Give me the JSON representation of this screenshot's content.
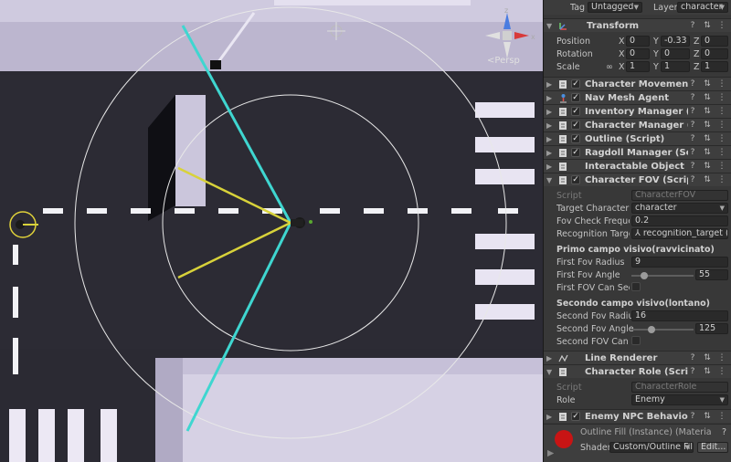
{
  "scene": {
    "persp_label": "Persp",
    "gizmo": {
      "x": "x",
      "y": "y",
      "z": "z"
    }
  },
  "inspector": {
    "top": {
      "tag_label": "Tag",
      "tag_value": "Untagged",
      "layer_label": "Layer",
      "layer_value": "character"
    },
    "transform": {
      "title": "Transform",
      "position_label": "Position",
      "position": {
        "x": "0",
        "y": "-0.33",
        "z": "0"
      },
      "rotation_label": "Rotation",
      "rotation": {
        "x": "0",
        "y": "0",
        "z": "0"
      },
      "scale_label": "Scale",
      "scale": {
        "x": "1",
        "y": "1",
        "z": "1"
      }
    },
    "components": [
      "Character Movement (Script)",
      "Nav Mesh Agent",
      "Inventory Manager (Script)",
      "Character Manager (Script)",
      "Outline (Script)",
      "Ragdoll Manager (Script)",
      "Interactable Object (Script)",
      "Character FOV (Script)"
    ],
    "fov": {
      "script_label": "Script",
      "script_value": "CharacterFOV",
      "target_label": "Target Character Ma",
      "target_value": "character",
      "freq_label": "Fov Check Frequenc",
      "freq_value": "0.2",
      "recog_label": "Recognition Target",
      "recog_value": "recognition_target (Tr",
      "primo_title": "Primo campo visivo(ravvicinato)",
      "first_radius_label": "First Fov Radius",
      "first_radius_value": "9",
      "first_angle_label": "First Fov Angle",
      "first_angle_value": "55",
      "first_see_label": "First FOV Can See Pla",
      "secondo_title": "Secondo campo visivo(lontano)",
      "second_radius_label": "Second Fov Radius",
      "second_radius_value": "16",
      "second_angle_label": "Second Fov Angle",
      "second_angle_value": "125",
      "second_see_label": "Second FOV Can See"
    },
    "line_renderer": "Line Renderer",
    "role": {
      "title": "Character Role (Script)",
      "script_label": "Script",
      "script_value": "CharacterRole",
      "role_label": "Role",
      "role_value": "Enemy"
    },
    "enemy": "Enemy NPC Behaviour (Script",
    "material": {
      "name": "Outline Fill (Instance) (Materia",
      "shader_label": "Shader",
      "shader_value": "Custom/Outline Fill",
      "edit_label": "Edit..."
    },
    "colors": {
      "accent": "#c81414",
      "fov_cyan": "#3fd6d0",
      "fov_yellow": "#d8d23a"
    }
  }
}
